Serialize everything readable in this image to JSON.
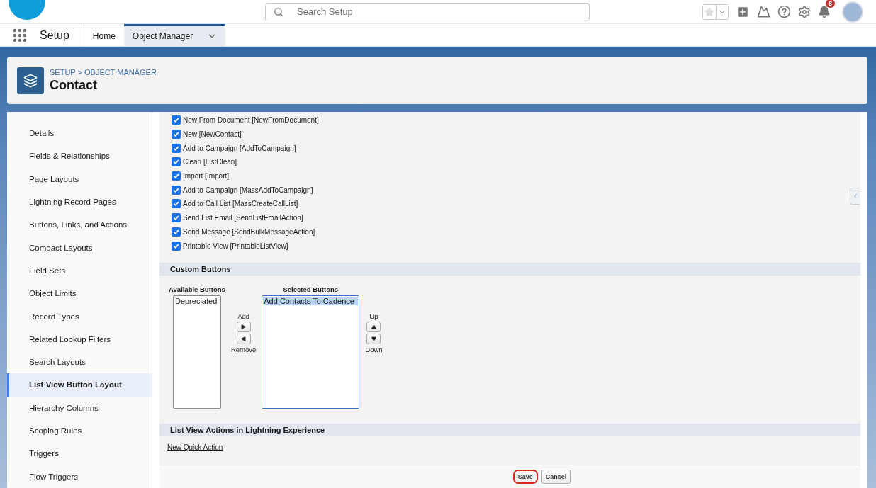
{
  "global_header": {
    "search": {
      "placeholder": "Search Setup"
    },
    "notification_count": "8"
  },
  "nav": {
    "app_name": "Setup",
    "tabs": [
      {
        "label": "Home",
        "selected": false
      },
      {
        "label": "Object Manager",
        "selected": true
      }
    ]
  },
  "page_header": {
    "breadcrumb": "SETUP > OBJECT MANAGER",
    "title": "Contact"
  },
  "sidebar": {
    "items": [
      {
        "label": "Details",
        "selected": false
      },
      {
        "label": "Fields & Relationships",
        "selected": false
      },
      {
        "label": "Page Layouts",
        "selected": false
      },
      {
        "label": "Lightning Record Pages",
        "selected": false
      },
      {
        "label": "Buttons, Links, and Actions",
        "selected": false
      },
      {
        "label": "Compact Layouts",
        "selected": false
      },
      {
        "label": "Field Sets",
        "selected": false
      },
      {
        "label": "Object Limits",
        "selected": false
      },
      {
        "label": "Record Types",
        "selected": false
      },
      {
        "label": "Related Lookup Filters",
        "selected": false
      },
      {
        "label": "Search Layouts",
        "selected": false
      },
      {
        "label": "List View Button Layout",
        "selected": true
      },
      {
        "label": "Hierarchy Columns",
        "selected": false
      },
      {
        "label": "Scoping Rules",
        "selected": false
      },
      {
        "label": "Triggers",
        "selected": false
      },
      {
        "label": "Flow Triggers",
        "selected": false
      }
    ]
  },
  "standard_buttons": [
    {
      "label": "New From Document [NewFromDocument]",
      "checked": true
    },
    {
      "label": "New [NewContact]",
      "checked": true
    },
    {
      "label": "Add to Campaign [AddToCampaign]",
      "checked": true
    },
    {
      "label": "Clean [ListClean]",
      "checked": true
    },
    {
      "label": "Import [Import]",
      "checked": true
    },
    {
      "label": "Add to Campaign [MassAddToCampaign]",
      "checked": true
    },
    {
      "label": "Add to Call List [MassCreateCallList]",
      "checked": true
    },
    {
      "label": "Send List Email [SendListEmailAction]",
      "checked": true
    },
    {
      "label": "Send Message [SendBulkMessageAction]",
      "checked": true
    },
    {
      "label": "Printable View [PrintableListView]",
      "checked": true
    }
  ],
  "custom_buttons": {
    "title": "Custom Buttons",
    "available": {
      "label": "Available Buttons",
      "focused": false,
      "options": [
        {
          "label": "Depreciated",
          "selected": false
        }
      ]
    },
    "add_label": "Add",
    "remove_label": "Remove",
    "selected": {
      "label": "Selected Buttons",
      "focused": true,
      "options": [
        {
          "label": "Add Contacts To Cadence",
          "selected": true
        }
      ]
    },
    "up_label": "Up",
    "down_label": "Down"
  },
  "lightning_actions": {
    "title": "List View Actions in Lightning Experience",
    "link": "New Quick Action"
  },
  "buttons": [
    {
      "label": "Save",
      "focused": true
    },
    {
      "label": "Cancel",
      "focused": false
    }
  ]
}
